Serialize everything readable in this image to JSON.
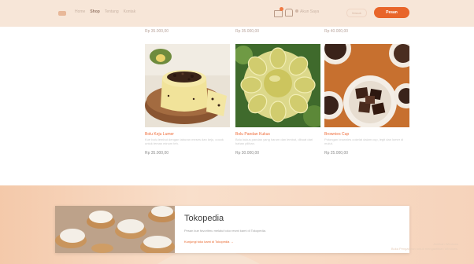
{
  "header": {
    "nav": [
      {
        "label": "Home",
        "active": false
      },
      {
        "label": "Shop",
        "active": true
      },
      {
        "label": "Tentang",
        "active": false
      },
      {
        "label": "Kontak",
        "active": false
      }
    ],
    "account_label": "Akun Saya",
    "ghost_button_label": "Masuk",
    "order_button_label": "Pesan",
    "accent_color": "#e8652a"
  },
  "previous_row_prices": [
    "Rp 35.000,00",
    "Rp 35.000,00",
    "Rp 40.000,00"
  ],
  "products": [
    {
      "title": "Bolu Keju Lumer",
      "description": "Kue bolu lembut dengan taburan meses dan keju, cocok untuk teman minum teh.",
      "price": "Rp 35.000,00"
    },
    {
      "title": "Bolu Pandan Kukus",
      "description": "Bolu kukus pandan yang harum dan lembut, dibuat dari bahan pilihan.",
      "price": "Rp 30.000,00"
    },
    {
      "title": "Brownies Cup",
      "description": "Potongan brownies cokelat dalam cup, legit dan lumer di mulut.",
      "price": "Rp 25.000,00"
    }
  ],
  "promo": {
    "title": "Tokopedia",
    "subtitle": "Pesan kue favoritmu melalui toko resmi kami di Tokopedia.",
    "link": "Kunjungi toko kami di Tokopedia →"
  },
  "watermark": {
    "line1": "Aktifkan Windows",
    "line2": "Buka Pengaturan untuk mengaktifkan Windows."
  }
}
